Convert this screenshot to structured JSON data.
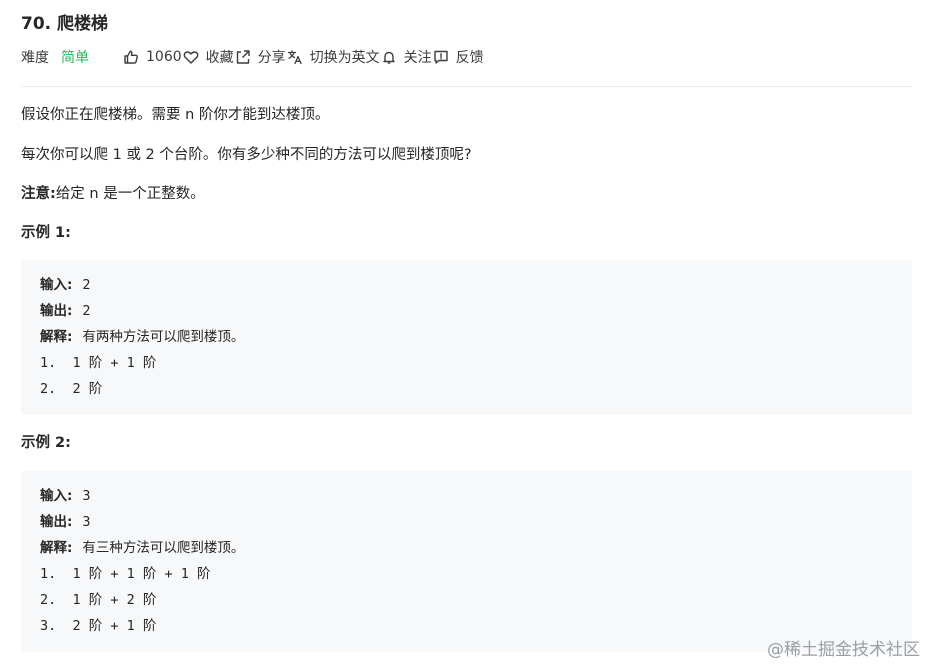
{
  "problem": {
    "title": "70. 爬楼梯"
  },
  "meta": {
    "difficulty_label": "难度",
    "difficulty_value": "简单",
    "likes": "1060",
    "favorite_label": "收藏",
    "share_label": "分享",
    "translate_label": "切换为英文",
    "follow_label": "关注",
    "feedback_label": "反馈",
    "difficulty_color": "#2db55d"
  },
  "description": {
    "p1": "假设你正在爬楼梯。需要 n 阶你才能到达楼顶。",
    "p2": "每次你可以爬 1 或 2 个台阶。你有多少种不同的方法可以爬到楼顶呢?",
    "note_label": "注意:",
    "note_text": "给定 n 是一个正整数。"
  },
  "examples": [
    {
      "title": "示例 1:",
      "input_label": "输入:",
      "input": "2",
      "output_label": "输出:",
      "output": "2",
      "explain_label": "解释:",
      "explain": "有两种方法可以爬到楼顶。",
      "steps": [
        "1.  1 阶 + 1 阶",
        "2.  2 阶"
      ]
    },
    {
      "title": "示例 2:",
      "input_label": "输入:",
      "input": "3",
      "output_label": "输出:",
      "output": "3",
      "explain_label": "解释:",
      "explain": "有三种方法可以爬到楼顶。",
      "steps": [
        "1.  1 阶 + 1 阶 + 1 阶",
        "2.  1 阶 + 2 阶",
        "3.  2 阶 + 1 阶"
      ]
    }
  ],
  "watermark": "@稀土掘金技术社区",
  "icons": [
    "thumbs-up-icon",
    "heart-icon",
    "share-icon",
    "translate-icon",
    "bell-icon",
    "feedback-icon"
  ]
}
